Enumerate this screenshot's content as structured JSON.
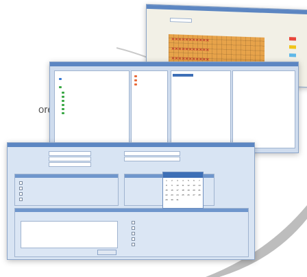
{
  "page": {
    "partial_text": "ore"
  },
  "plate_window": {
    "swatch_colors": [
      "#e8463a",
      "#f0c419",
      "#5fb8e8",
      "#e88a3a",
      "#a6d14a"
    ]
  },
  "list_window": {},
  "main_dialog": {
    "calendar": {
      "accent": "#3d6fb6",
      "days": [
        "1",
        "2",
        "3",
        "4",
        "5",
        "6",
        "7",
        "8",
        "9",
        "10",
        "11",
        "12",
        "13",
        "14",
        "15",
        "16",
        "17",
        "18",
        "19",
        "20",
        "21",
        "22",
        "23",
        "24",
        "25",
        "26",
        "27",
        "28",
        "29",
        "30",
        "31"
      ]
    }
  }
}
